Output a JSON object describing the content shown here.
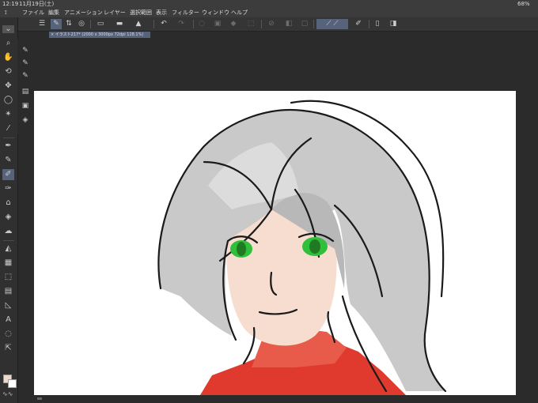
{
  "status": {
    "time": "12:19",
    "date": "11月19日(土)",
    "battery": "68%"
  },
  "menu": [
    "ファイル",
    "編集",
    "アニメーション",
    "レイヤー",
    "選択範囲",
    "表示",
    "フィルター",
    "ウィンドウ",
    "ヘルプ"
  ],
  "tab": {
    "title": "イラスト217* (2000 x 3000px 72dpi 128.1%)"
  },
  "colors": {
    "main": "#f1d7c9",
    "sub": "#ffffff",
    "accent": "#56637b"
  },
  "icons": {
    "tools": [
      "magnifier-icon",
      "hand-icon",
      "rotate-icon",
      "move-icon",
      "lasso-select-icon",
      "magic-wand-icon",
      "eyedropper-icon",
      "pen-icon",
      "pencil-icon",
      "brush-icon",
      "airbrush-icon",
      "decoration-icon",
      "eraser-icon",
      "blend-icon",
      "fill-icon",
      "gradient-icon",
      "frame-icon",
      "ruler-icon",
      "text-icon",
      "balloon-icon",
      "object-select-icon"
    ],
    "toolbar": [
      "menu-icon",
      "brush-size-icon",
      "stepper-icon",
      "view-icon",
      "new-icon",
      "open-icon",
      "save-icon",
      "undo-icon",
      "redo-icon",
      "clear-icon",
      "transform-icon",
      "fill-tool-icon",
      "select-icon",
      "layer-icon",
      "layer2-icon",
      "stabilizer-icon",
      "pen-pressure-icon",
      "snap-icon",
      "device-icon",
      "help-icon"
    ]
  }
}
